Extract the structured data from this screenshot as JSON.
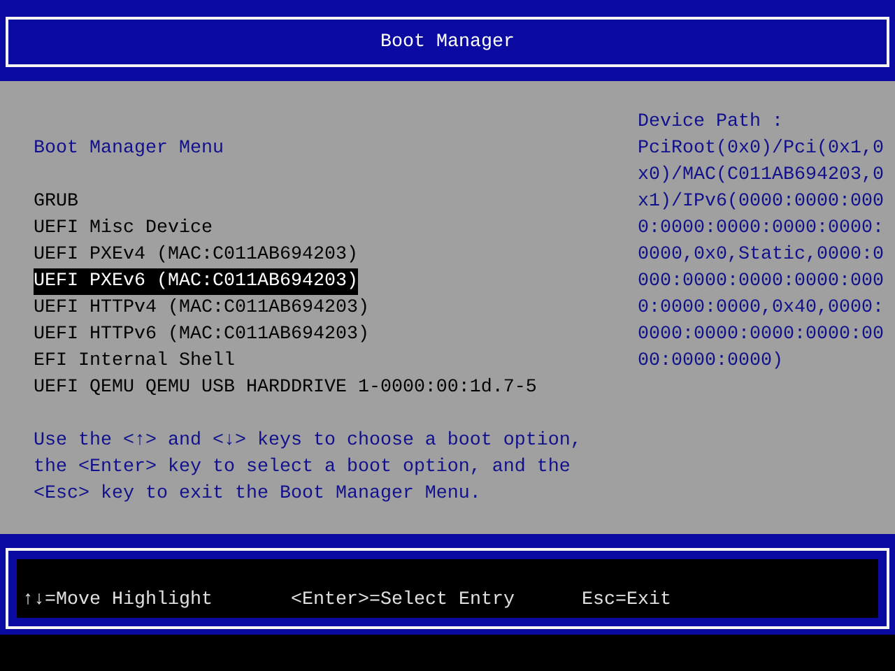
{
  "header": {
    "title": "Boot Manager"
  },
  "menu": {
    "title": "Boot Manager Menu",
    "items": [
      {
        "label": "GRUB",
        "selected": false
      },
      {
        "label": "UEFI Misc Device",
        "selected": false
      },
      {
        "label": "UEFI PXEv4 (MAC:C011AB694203)",
        "selected": false
      },
      {
        "label": "UEFI PXEv6 (MAC:C011AB694203)",
        "selected": true
      },
      {
        "label": "UEFI HTTPv4 (MAC:C011AB694203)",
        "selected": false
      },
      {
        "label": "UEFI HTTPv6 (MAC:C011AB694203)",
        "selected": false
      },
      {
        "label": "EFI Internal Shell",
        "selected": false
      },
      {
        "label": "UEFI QEMU QEMU USB HARDDRIVE 1-0000:00:1d.7-5",
        "selected": false
      }
    ],
    "help": "Use the <↑> and <↓> keys to choose a boot option, the <Enter> key to select a boot option, and the <Esc> key to exit the Boot Manager Menu."
  },
  "device_path": {
    "label": "Device Path :",
    "value": "PciRoot(0x0)/Pci(0x1,0x0)/MAC(C011AB694203,0x1)/IPv6(0000:0000:0000:0000:0000:0000:0000:0000,0x0,Static,0000:0000:0000:0000:0000:0000:0000:0000,0x40,0000:0000:0000:0000:0000:0000:0000:0000)"
  },
  "footer": {
    "keys": [
      "↑↓=Move Highlight",
      "<Enter>=Select Entry",
      "Esc=Exit"
    ]
  }
}
